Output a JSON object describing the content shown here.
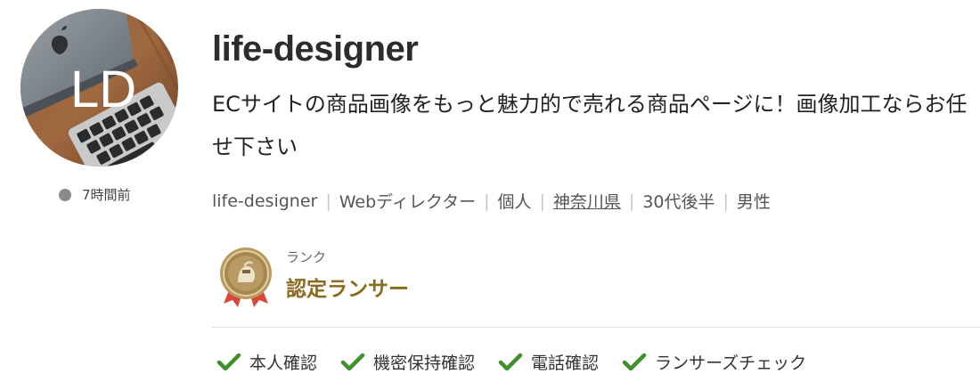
{
  "profile": {
    "avatar_text": "LD",
    "last_active": "7時間前",
    "name": "life-designer",
    "catchphrase": "ECサイトの商品画像をもっと魅力的で売れる商品ページに！画像加工ならお任せ下さい",
    "meta": {
      "username": "life-designer",
      "occupation": "Webディレクター",
      "type": "個人",
      "location": "神奈川県",
      "age": "30代後半",
      "gender": "男性"
    },
    "rank": {
      "label": "ランク",
      "value": "認定ランサー"
    },
    "verifications": [
      {
        "label": "本人確認"
      },
      {
        "label": "機密保持確認"
      },
      {
        "label": "電話確認"
      },
      {
        "label": "ランサーズチェック"
      }
    ]
  },
  "colors": {
    "check": "#3f8f2c",
    "rank_text": "#8a6a1d",
    "status_dot": "#8a8a8a"
  }
}
